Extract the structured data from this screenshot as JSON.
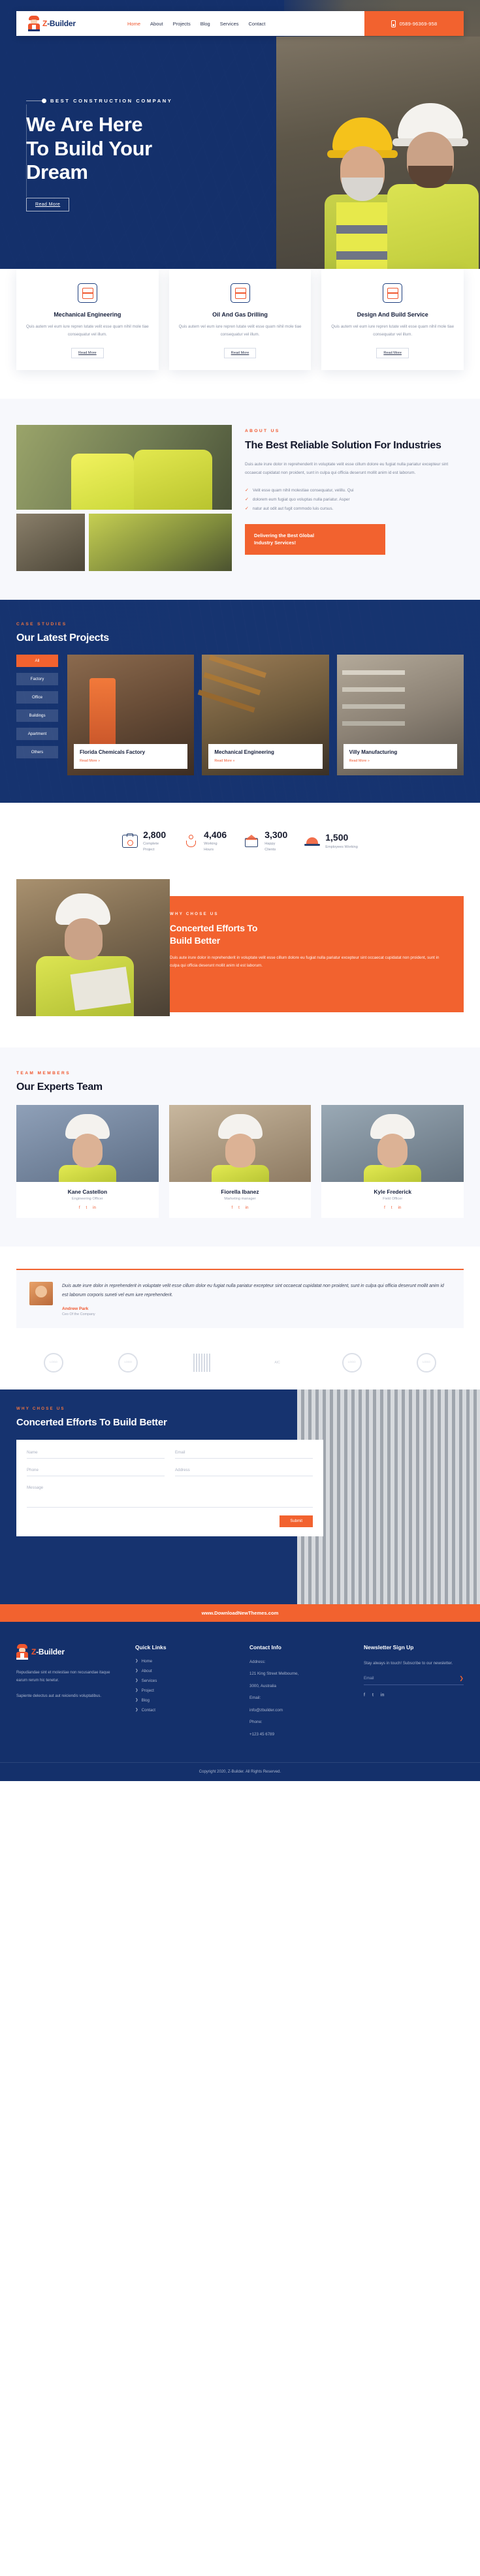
{
  "brand": {
    "prefix": "Z",
    "suffix": "-Builder"
  },
  "nav": {
    "items": [
      {
        "label": "Home",
        "active": true
      },
      {
        "label": "About",
        "active": false
      },
      {
        "label": "Projects",
        "active": false
      },
      {
        "label": "Blog",
        "active": false
      },
      {
        "label": "Services",
        "active": false
      },
      {
        "label": "Contact",
        "active": false
      }
    ],
    "phone": "0589-96369-958"
  },
  "hero": {
    "eyebrow": "BEST CONSTRUCTION COMPANY",
    "title_line1": "We Are Here",
    "title_line2": "To Build Your",
    "title_line3": "Dream",
    "button": "Read More"
  },
  "services": [
    {
      "title": "Mechanical Engineering",
      "text": "Quis autem vel eum iure repren lutate velit esse quam nihil mole tiae consequatur vel illum.",
      "button": "Read More",
      "icon": "blueprint-icon"
    },
    {
      "title": "Oil And Gas Drilling",
      "text": "Quis autem vel eum iure repren lutate velit esse quam nihil mole tiae consequatur vel illum.",
      "button": "Read More",
      "icon": "drill-icon"
    },
    {
      "title": "Design And Build Service",
      "text": "Quis autem vel eum iure repren lutate velit esse quam nihil mole tiae consequatur vel illum.",
      "button": "Read More",
      "icon": "factory-icon"
    }
  ],
  "about": {
    "eyebrow": "ABOUT US",
    "title": "The Best Reliable Solution For Industries",
    "paragraph": "Duis aute irure dolor in reprehenderit in voluptate velit esse cillum dolore eu fugiat nulla pariatur excepteur sint occaecat cupidatat non proident, sunt in culpa qui officia deserunt mollit anim id est laborum.",
    "checks": [
      "Velit esse quam nihil molestiae consequatur, velillu. Qui",
      "dolorem eum fugiat quo voluptas nulla pariatur. Asper",
      "natur aut odit aut fugit commodo luis cursus."
    ],
    "cta_line1": "Delivering the Best Global",
    "cta_line2": "Industry Services!"
  },
  "projects": {
    "eyebrow": "CASE STUDIES",
    "title": "Our Latest Projects",
    "filters": [
      {
        "label": "All",
        "active": true
      },
      {
        "label": "Factory",
        "active": false
      },
      {
        "label": "Office",
        "active": false
      },
      {
        "label": "Buildings",
        "active": false
      },
      {
        "label": "Apartment",
        "active": false
      },
      {
        "label": "Others",
        "active": false
      }
    ],
    "cards": [
      {
        "title": "Florida Chemicals Factory",
        "link": "Read More »"
      },
      {
        "title": "Mechanical Engineering",
        "link": "Read More »"
      },
      {
        "title": "Villy Manufacturing",
        "link": "Read More »"
      }
    ]
  },
  "stats": [
    {
      "number": "2,800",
      "label_line1": "Complete",
      "label_line2": "Project",
      "icon": "briefcase-gear-icon"
    },
    {
      "number": "4,406",
      "label_line1": "Working",
      "label_line2": "Hours",
      "icon": "worker-icon"
    },
    {
      "number": "3,300",
      "label_line1": "Happy",
      "label_line2": "Clients",
      "icon": "house-icon"
    },
    {
      "number": "1,500",
      "label_line1": "Employees Working",
      "label_line2": "",
      "icon": "helmet-icon"
    }
  ],
  "why": {
    "eyebrow": "WHY CHOSE US",
    "title_line1": "Concerted Efforts To",
    "title_line2": "Build Better",
    "paragraph": "Duis aute irure dolor in reprehenderit in voluptate velit esse cillum dolore eu fugiat nulla pariatur excepteur sint occaecat cupidatat non proident, sunt in culpa qui officia deserunt mollit anim id est laborum."
  },
  "team": {
    "eyebrow": "TEAM MEMBERS",
    "title": "Our Experts Team",
    "members": [
      {
        "name": "Kane Castellon",
        "role": "Engineering Officer",
        "photo": "female-engineer"
      },
      {
        "name": "Fiorella Ibanez",
        "role": "Marketing manager",
        "photo": "female-manager"
      },
      {
        "name": "Kyle Frederick",
        "role": "Field Officer",
        "photo": "male-officer"
      }
    ],
    "social": [
      "f",
      "t",
      "in"
    ]
  },
  "testimonial": {
    "quote": "Duis aute irure dolor in reprehenderit in voluptate velit esse cillum dolor eu fugiat nulla pariatur excepteur sint occaecat cupidatat non proident, sunt in culpa qui officia deserunt mollit anim id est laborum corporis suneti vel eum iure reprehenderit.",
    "name": "Andrew Park",
    "role": "Ceo Of the Company"
  },
  "partners": [
    "LOGO",
    "LOGO",
    "AIC",
    "LOGO",
    "LOGO"
  ],
  "contact": {
    "eyebrow": "WHY CHOSE US",
    "title": "Concerted Efforts To Build Better",
    "fields": {
      "name": "Name",
      "email": "Email",
      "phone": "Phone",
      "address": "Address",
      "message": "Message"
    },
    "submit": "Submit",
    "url": "www.DownloadNewThemes.com"
  },
  "footer": {
    "about_p1": "Repudiandae sint et molestiae non recusandae itaque earum rerum hic tenetur.",
    "about_p2": "Sapiente delectus aut aut reiciendis voluptatibus.",
    "quick_links_title": "Quick Links",
    "quick_links": [
      "Home",
      "About",
      "Services",
      "Project",
      "Blog",
      "Contact"
    ],
    "contact_title": "Contact Info",
    "contact_lines": [
      "Address:",
      "121 King Street Melbourne,",
      "3000, Australia",
      "Email:",
      "info@zbuilder.com",
      "Phone:",
      "+123 45 6789"
    ],
    "newsletter_title": "Newsletter Sign Up",
    "newsletter_text": "Stay always in touch! Subscribe to our newsletter.",
    "newsletter_placeholder": "Email",
    "social": [
      "f",
      "t",
      "in"
    ],
    "copyright": "Copyright 2020, Z-Builder. All Rights Reserved."
  }
}
